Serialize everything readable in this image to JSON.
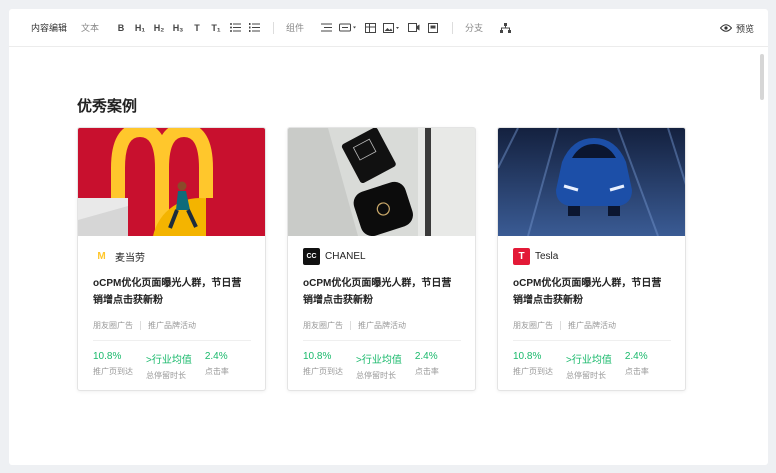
{
  "toolbar": {
    "content_edit": "内容编辑",
    "text": "文本",
    "bold": "B",
    "h1": "H₁",
    "h2": "H₂",
    "h3": "H₃",
    "t1": "T",
    "t2": "T₁",
    "components": "组件",
    "branch": "分支",
    "preview": "预览"
  },
  "section": {
    "title": "优秀案例"
  },
  "colors": {
    "accent_green": "#19b96b",
    "mcd_red": "#c8102e",
    "mcd_yellow": "#ffc72c",
    "tesla_red": "#e31937"
  },
  "cards": [
    {
      "brand": "麦当劳",
      "logo_text": "M",
      "headline": "oCPM优化页面曝光人群，节日营销增点击获新粉",
      "tags": [
        "朋友圈广告",
        "推广品牌活动"
      ],
      "metrics": [
        {
          "value": "10.8%",
          "label": "推广页到达"
        },
        {
          "value": ">行业均值",
          "label": "总停留时长"
        },
        {
          "value": "2.4%",
          "label": "点击率"
        }
      ]
    },
    {
      "brand": "CHANEL",
      "logo_text": "CC",
      "headline": "oCPM优化页面曝光人群，节日营销增点击获新粉",
      "tags": [
        "朋友圈广告",
        "推广品牌活动"
      ],
      "metrics": [
        {
          "value": "10.8%",
          "label": "推广页到达"
        },
        {
          "value": ">行业均值",
          "label": "总停留时长"
        },
        {
          "value": "2.4%",
          "label": "点击率"
        }
      ]
    },
    {
      "brand": "Tesla",
      "logo_text": "T",
      "headline": "oCPM优化页面曝光人群，节日营销增点击获新粉",
      "tags": [
        "朋友圈广告",
        "推广品牌活动"
      ],
      "metrics": [
        {
          "value": "10.8%",
          "label": "推广页到达"
        },
        {
          "value": ">行业均值",
          "label": "总停留时长"
        },
        {
          "value": "2.4%",
          "label": "点击率"
        }
      ]
    }
  ]
}
